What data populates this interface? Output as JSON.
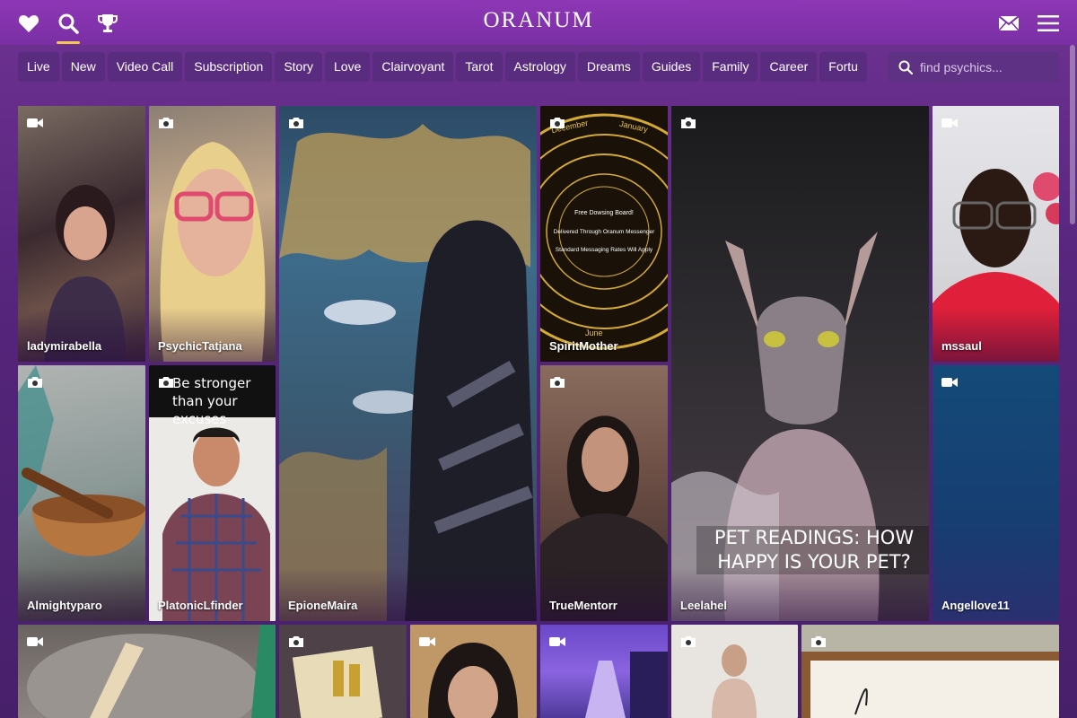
{
  "header": {
    "logo_text": "ORANUM",
    "icons": [
      "heart-icon",
      "search-icon",
      "trophy-icon",
      "mail-icon",
      "menu-icon"
    ]
  },
  "categories": [
    "Live",
    "New",
    "Video Call",
    "Subscription",
    "Story",
    "Love",
    "Clairvoyant",
    "Tarot",
    "Astrology",
    "Dreams",
    "Guides",
    "Family",
    "Career",
    "Fortu"
  ],
  "search": {
    "placeholder": "find psychics..."
  },
  "tiles": [
    {
      "name": "ladymirabella",
      "media": "video"
    },
    {
      "name": "PsychicTatjana",
      "media": "photo"
    },
    {
      "name": "EpioneMaira",
      "media": "photo"
    },
    {
      "name": "SpiritMother",
      "media": "photo"
    },
    {
      "name": "Leelahel",
      "media": "photo"
    },
    {
      "name": "mssaul",
      "media": "video"
    },
    {
      "name": "Almightyparo",
      "media": "photo"
    },
    {
      "name": "PlatonicLfinder",
      "media": "photo"
    },
    {
      "name": "TrueMentorr",
      "media": "photo"
    },
    {
      "name": "Angellove11",
      "media": "video"
    },
    {
      "name": "",
      "media": "video"
    },
    {
      "name": "",
      "media": "photo"
    },
    {
      "name": "",
      "media": "video"
    },
    {
      "name": "",
      "media": "video"
    },
    {
      "name": "",
      "media": "photo"
    },
    {
      "name": "",
      "media": "photo"
    }
  ],
  "overlays": {
    "platonic_quote": "Be stronger than your excuses",
    "leelahel_caption": "PET READINGS: HOW HAPPY IS YOUR PET?",
    "spirit_board": {
      "month_top_left": "December",
      "month_top_right": "January",
      "month_bottom": "June",
      "line1": "Free Dowsing Board!",
      "line2": "Delivered Through Oranum Messenger",
      "line3": "Standard Messaging Rates Will Apply"
    }
  },
  "colors": {
    "header": "#8e37b6",
    "pill": "#5a2c7f",
    "accent": "#f2c94c"
  }
}
